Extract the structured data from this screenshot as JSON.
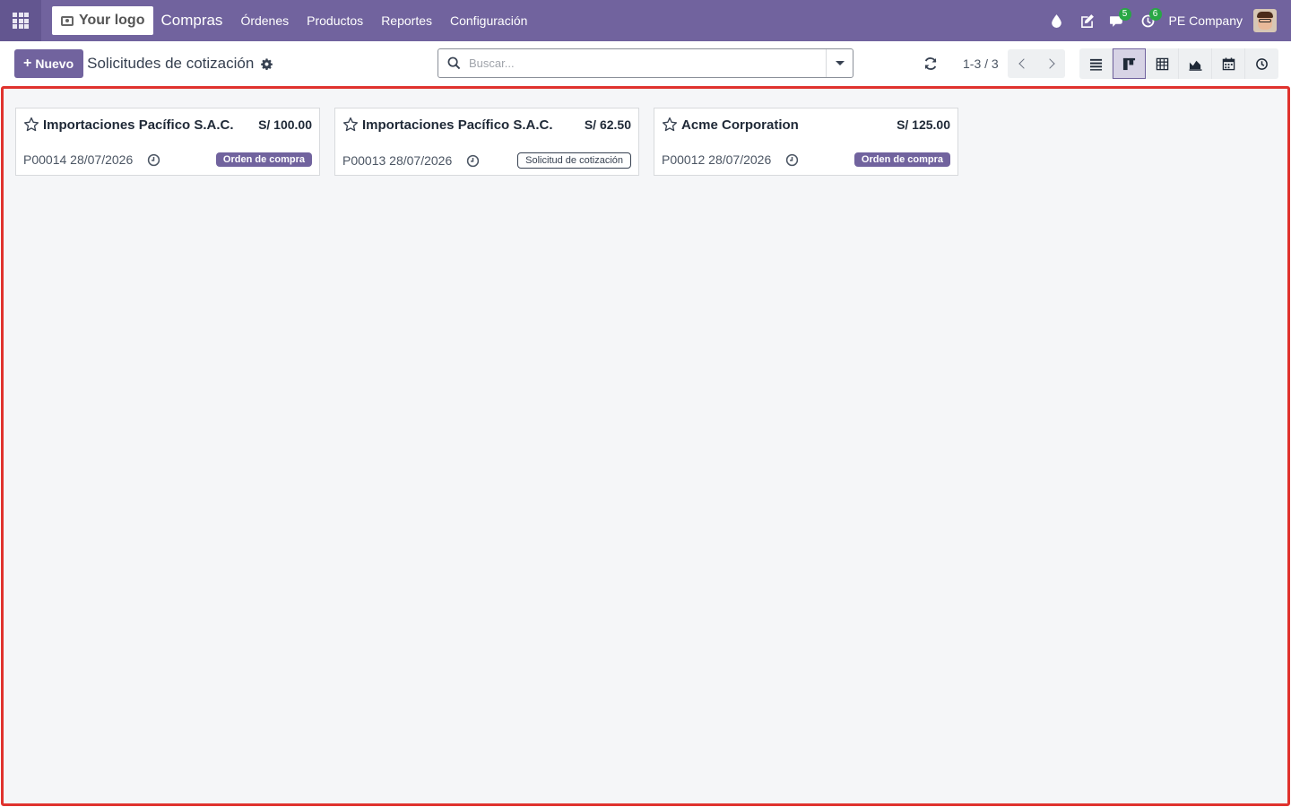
{
  "navbar": {
    "logo_text": "Your logo",
    "app_name": "Compras",
    "menu": [
      "Órdenes",
      "Productos",
      "Reportes",
      "Configuración"
    ],
    "messages_count": "5",
    "activities_count": "6",
    "company": "PE Company"
  },
  "control": {
    "new_label": "Nuevo",
    "breadcrumb": "Solicitudes de cotización",
    "search_placeholder": "Buscar...",
    "pager": "1-3 / 3"
  },
  "cards": [
    {
      "partner": "Importaciones Pacífico S.A.C.",
      "amount": "S/ 100.00",
      "ref": "P00014 28/07/2026",
      "status": "Orden de compra",
      "status_style": "filled"
    },
    {
      "partner": "Importaciones Pacífico S.A.C.",
      "amount": "S/ 62.50",
      "ref": "P00013 28/07/2026",
      "status": "Solicitud de cotización",
      "status_style": "outline"
    },
    {
      "partner": "Acme Corporation",
      "amount": "S/ 125.00",
      "ref": "P00012 28/07/2026",
      "status": "Orden de compra",
      "status_style": "filled"
    }
  ],
  "colors": {
    "brand": "#71639e",
    "highlight_border": "#e0332e",
    "badge_green": "#28a745"
  },
  "icons": [
    "apps-grid-icon",
    "camera-icon",
    "droplet-icon",
    "edit-icon",
    "chat-icon",
    "activity-clock-icon",
    "gear-icon",
    "search-icon",
    "reload-icon",
    "list-view-icon",
    "kanban-view-icon",
    "pivot-view-icon",
    "graph-view-icon",
    "calendar-view-icon",
    "activity-view-icon",
    "star-icon",
    "clock-icon"
  ]
}
